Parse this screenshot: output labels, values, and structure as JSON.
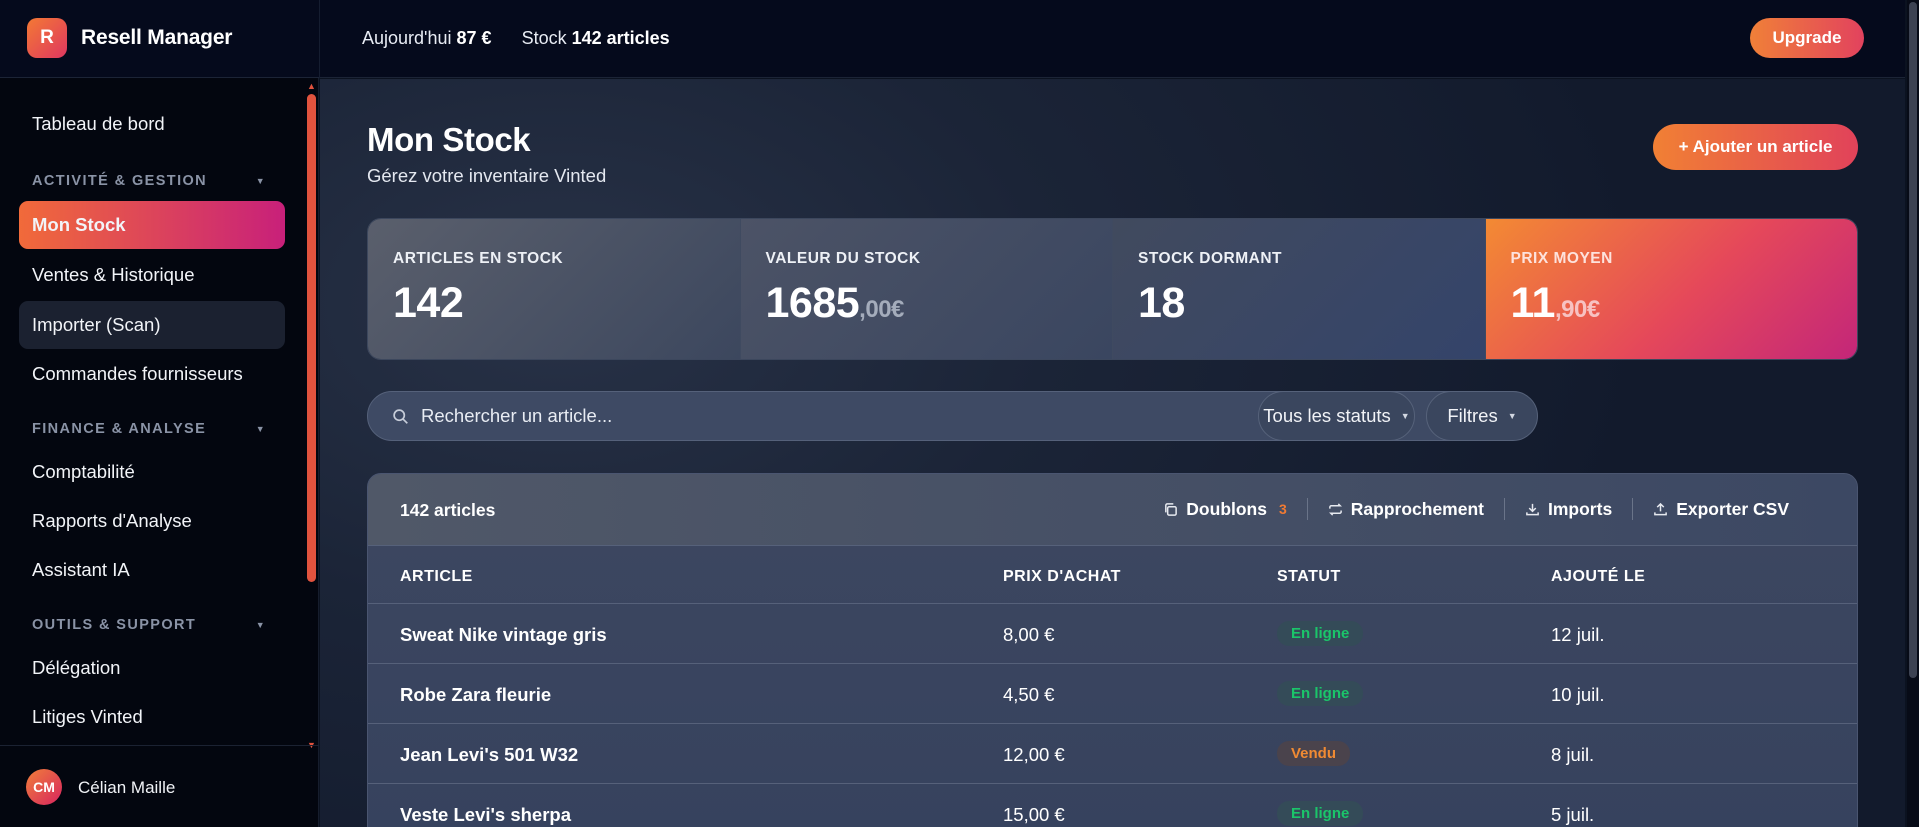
{
  "app": {
    "logo_letter": "R",
    "name": "Resell Manager"
  },
  "topbar": {
    "today_label": "Aujourd'hui",
    "today_value": "87 €",
    "stock_label": "Stock",
    "stock_value": "142 articles",
    "upgrade_label": "Upgrade"
  },
  "sidebar": {
    "dashboard": "Tableau de bord",
    "sections": [
      {
        "title": "ACTIVITÉ & GESTION",
        "items": [
          "Mon Stock",
          "Ventes & Historique",
          "Importer (Scan)",
          "Commandes fournisseurs"
        ]
      },
      {
        "title": "FINANCE & ANALYSE",
        "items": [
          "Comptabilité",
          "Rapports d'Analyse",
          "Assistant IA"
        ]
      },
      {
        "title": "OUTILS & SUPPORT",
        "items": [
          "Délégation",
          "Litiges Vinted"
        ]
      }
    ],
    "active_item": "Mon Stock",
    "user": {
      "initials": "CM",
      "name": "Célian Maille"
    }
  },
  "page": {
    "title": "Mon Stock",
    "subtitle": "Gérez votre inventaire Vinted",
    "add_button": "+ Ajouter un article"
  },
  "kpis": [
    {
      "label": "ARTICLES EN STOCK",
      "value": "142",
      "decimals": ""
    },
    {
      "label": "VALEUR DU STOCK",
      "value": "1685",
      "decimals": ",00€"
    },
    {
      "label": "STOCK DORMANT",
      "value": "18",
      "decimals": ""
    },
    {
      "label": "PRIX MOYEN",
      "value": "11",
      "decimals": ",90€"
    }
  ],
  "filters": {
    "search_placeholder": "Rechercher un article...",
    "status_select": "Tous les statuts",
    "filters_button": "Filtres"
  },
  "table": {
    "count": "142 articles",
    "actions": {
      "duplicates": "Doublons",
      "duplicates_count": "3",
      "reconcile": "Rapprochement",
      "imports": "Imports",
      "export": "Exporter CSV"
    },
    "columns": [
      "ARTICLE",
      "PRIX D'ACHAT",
      "STATUT",
      "AJOUTÉ LE"
    ],
    "rows": [
      {
        "name": "Sweat Nike vintage gris",
        "price": "8,00 €",
        "status": "En ligne",
        "date": "12 juil."
      },
      {
        "name": "Robe Zara fleurie",
        "price": "4,50 €",
        "status": "En ligne",
        "date": "10 juil."
      },
      {
        "name": "Jean Levi's 501 W32",
        "price": "12,00 €",
        "status": "Vendu",
        "date": "8 juil."
      },
      {
        "name": "Veste Levi's sherpa",
        "price": "15,00 €",
        "status": "En ligne",
        "date": "5 juil."
      }
    ]
  },
  "colors": {
    "accent_start": "#f38a33",
    "accent_end": "#c32679",
    "status_online": "#1bc56a",
    "status_sold": "#f08a33"
  }
}
